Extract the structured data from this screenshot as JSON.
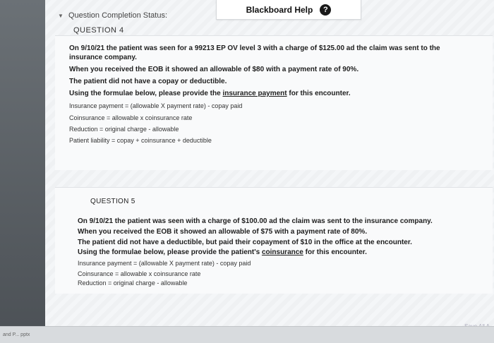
{
  "header": {
    "status_label": "Question Completion Status:",
    "help_title": "Blackboard Help",
    "help_glyph": "?"
  },
  "q4": {
    "label": "QUESTION 4",
    "lines": [
      "On 9/10/21 the patient was seen for a 99213 EP OV level 3 with a charge of $125.00 ad the claim was sent to the",
      "insurance company.",
      "When you received the EOB it showed an allowable of $80 with a payment rate of 90%.",
      "The patient did not have a copay or deductible.",
      "Using the formulae below, please provide the",
      "insurance payment",
      "for this encounter.",
      "Insurance payment = (allowable X payment rate) - copay paid",
      "Coinsurance = allowable x coinsurance rate",
      "Reduction = original charge - allowable",
      "Patient liability = copay + coinsurance + deductible"
    ]
  },
  "q5": {
    "label": "QUESTION 5",
    "lines": [
      "On 9/10/21 the patient was seen with a charge of $100.00 ad the claim was sent to the insurance company.",
      "When you received the EOB it showed an allowable of $75 with a payment rate of 80%.",
      "The patient did not have a deductible, but paid their copayment of $10 in the office at the encounter.",
      "Using the formulae below, please provide the patient's",
      "coinsurance",
      "for this encounter.",
      "Insurance payment = (allowable X payment rate) - copay paid",
      "Coinsurance = allowable x coinsurance rate",
      "Reduction = original charge - allowable"
    ]
  },
  "footer": {
    "taskbar_text": "and P... pptx",
    "save_label": "Save All A"
  }
}
